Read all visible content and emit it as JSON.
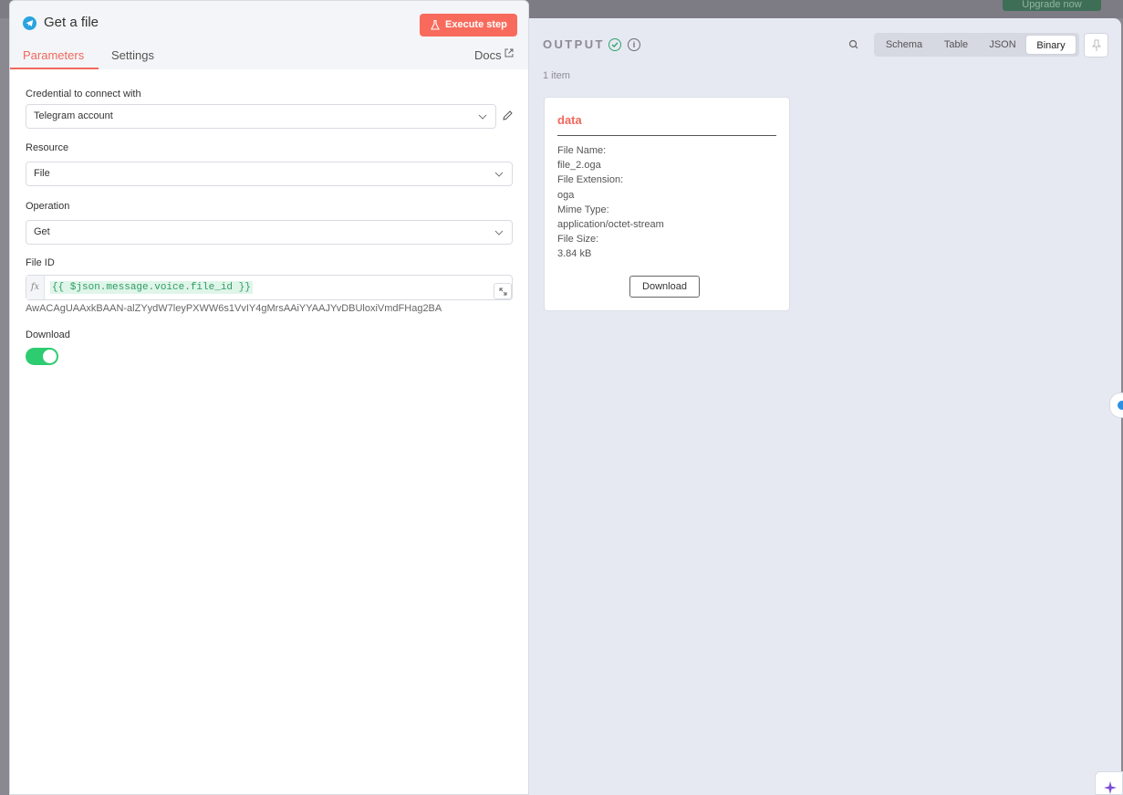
{
  "topbar": {
    "upgrade_label": "Upgrade now"
  },
  "node": {
    "title": "Get a file",
    "icon": "telegram-icon",
    "execute_label": "Execute step",
    "tabs": [
      "Parameters",
      "Settings"
    ],
    "active_tab": "Parameters",
    "docs_label": "Docs"
  },
  "params": {
    "credential": {
      "label": "Credential to connect with",
      "value": "Telegram account"
    },
    "resource": {
      "label": "Resource",
      "value": "File"
    },
    "operation": {
      "label": "Operation",
      "value": "Get"
    },
    "file_id": {
      "label": "File ID",
      "fx": "fx",
      "expression": "{{ $json.message.voice.file_id }}",
      "result": "AwACAgUAAxkBAAN-alZYydW7leyPXWW6s1VvIY4gMrsAAiYYAAJYvDBUloxiVmdFHag2BA"
    },
    "download": {
      "label": "Download",
      "enabled": true
    }
  },
  "output": {
    "title": "OUTPUT",
    "item_count": "1 item",
    "views": [
      "Schema",
      "Table",
      "JSON",
      "Binary"
    ],
    "active_view": "Binary",
    "binary": {
      "title": "data",
      "file_name_label": "File Name:",
      "file_name": "file_2.oga",
      "file_ext_label": "File Extension:",
      "file_ext": "oga",
      "mime_label": "Mime Type:",
      "mime": "application/octet-stream",
      "size_label": "File Size:",
      "size": "3.84 kB",
      "download_label": "Download"
    }
  },
  "colors": {
    "accent": "#f0685d",
    "execute": "#f86b5c",
    "success": "#2ecc71",
    "telegram": "#2aa3df"
  }
}
